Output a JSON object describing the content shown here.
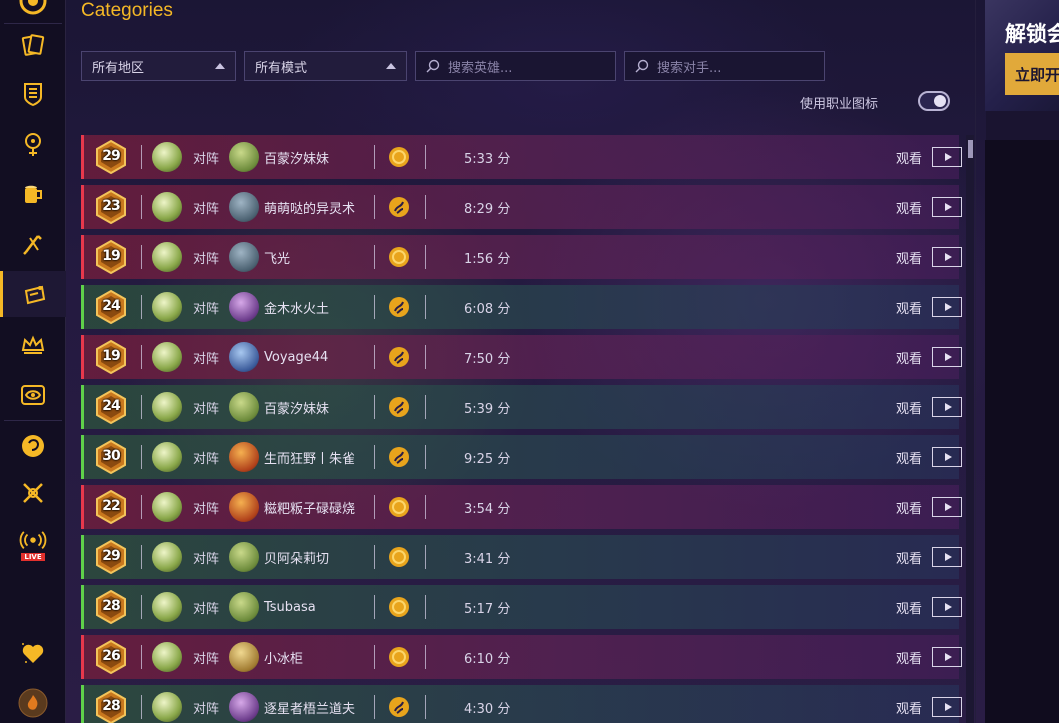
{
  "header": {
    "title": "Categories"
  },
  "filters": {
    "region": "所有地区",
    "mode": "所有模式",
    "hero_search_placeholder": "搜索英雄...",
    "opponent_search_placeholder": "搜索对手..."
  },
  "toggle": {
    "label": "使用职业图标",
    "on": true
  },
  "promo": {
    "title": "解锁会",
    "button": "立即开"
  },
  "list": {
    "vs_label": "对阵",
    "watch_label": "观看",
    "rows": [
      {
        "rank": "29",
        "result": "loss",
        "opponent": "百蒙汐妹妹",
        "mode_icon": "coin-icon",
        "duration": "5:33 分",
        "opp_portrait": "hero-green"
      },
      {
        "rank": "23",
        "result": "loss",
        "opponent": "萌萌哒的异灵术",
        "mode_icon": "duo-icon",
        "duration": "8:29 分",
        "opp_portrait": "hero-mech"
      },
      {
        "rank": "19",
        "result": "loss",
        "opponent": "飞光",
        "mode_icon": "coin-icon",
        "duration": "1:56 分",
        "opp_portrait": "hero-mech"
      },
      {
        "rank": "24",
        "result": "win",
        "opponent": "金木水火土",
        "mode_icon": "duo-icon",
        "duration": "6:08 分",
        "opp_portrait": "hero-purple"
      },
      {
        "rank": "19",
        "result": "loss",
        "opponent": "Voyage44",
        "mode_icon": "duo-icon",
        "duration": "7:50 分",
        "opp_portrait": "hero-blue"
      },
      {
        "rank": "24",
        "result": "win",
        "opponent": "百蒙汐妹妹",
        "mode_icon": "duo-icon",
        "duration": "5:39 分",
        "opp_portrait": "hero-green"
      },
      {
        "rank": "30",
        "result": "win",
        "opponent": "生而狂野丨朱雀",
        "mode_icon": "duo-icon",
        "duration": "9:25 分",
        "opp_portrait": "hero-fire"
      },
      {
        "rank": "22",
        "result": "loss",
        "opponent": "糍粑粄子碌碌烧",
        "mode_icon": "coin-icon",
        "duration": "3:54 分",
        "opp_portrait": "hero-fire"
      },
      {
        "rank": "29",
        "result": "win",
        "opponent": "贝阿朵莉切",
        "mode_icon": "coin-icon",
        "duration": "3:41 分",
        "opp_portrait": "hero-green"
      },
      {
        "rank": "28",
        "result": "win",
        "opponent": "Tsubasa",
        "mode_icon": "coin-icon",
        "duration": "5:17 分",
        "opp_portrait": "hero-green"
      },
      {
        "rank": "26",
        "result": "loss",
        "opponent": "小冰柜",
        "mode_icon": "coin-icon",
        "duration": "6:10 分",
        "opp_portrait": "hero-gold"
      },
      {
        "rank": "28",
        "result": "win",
        "opponent": "逐星者梧兰道夫",
        "mode_icon": "duo-icon",
        "duration": "4:30 分",
        "opp_portrait": "hero-purple"
      }
    ]
  },
  "colors": {
    "accent": "#f5b826",
    "loss": "#e8384c",
    "win": "#5fd14a"
  },
  "sidebar": {
    "icons": [
      "logo-icon",
      "cards-icon",
      "shield-icon",
      "class-icon",
      "tavern-icon",
      "arena-icon",
      "battlegrounds-icon",
      "crown-icon",
      "eye-icon",
      "mercenary-icon",
      "swords-icon",
      "live-icon",
      "heart-icon",
      "avatar-icon"
    ],
    "live_label": "LIVE"
  }
}
